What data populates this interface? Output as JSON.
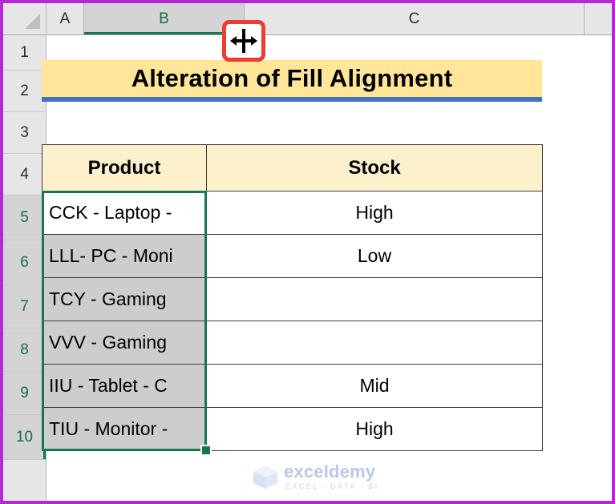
{
  "app": {
    "type": "spreadsheet",
    "colors": {
      "selection_green": "#16784a",
      "title_fill": "#ffe699",
      "title_underline": "#4472c4",
      "table_header_fill": "#fdf0cd",
      "selected_cell_fill": "#cdcdcd",
      "cursor_highlight": "#ee3b33",
      "outer_frame": "#b52ad0"
    }
  },
  "grid": {
    "select_all_corner": "select-all-triangle",
    "column_headers": [
      {
        "label": "A",
        "selected": false
      },
      {
        "label": "B",
        "selected": true
      },
      {
        "label": "C",
        "selected": false
      },
      {
        "label": "",
        "selected": false
      }
    ],
    "row_headers": [
      {
        "label": "1",
        "selected": false
      },
      {
        "label": "2",
        "selected": false
      },
      {
        "label": "3",
        "selected": false
      },
      {
        "label": "4",
        "selected": false
      },
      {
        "label": "5",
        "selected": true
      },
      {
        "label": "6",
        "selected": true
      },
      {
        "label": "7",
        "selected": true
      },
      {
        "label": "8",
        "selected": true
      },
      {
        "label": "9",
        "selected": true
      },
      {
        "label": "10",
        "selected": true
      }
    ]
  },
  "cursor": {
    "name": "column-resize-cursor",
    "glyph": "column-width-resize",
    "highlighted": true
  },
  "title": {
    "text": "Alteration of Fill Alignment"
  },
  "table": {
    "headers": [
      "Product",
      "Stock"
    ],
    "rows": [
      {
        "product": "CCK - Laptop -",
        "stock": "High",
        "active": true,
        "selected": true
      },
      {
        "product": "LLL- PC - Moni",
        "stock": "Low",
        "active": false,
        "selected": true
      },
      {
        "product": "TCY - Gaming",
        "stock": "",
        "active": false,
        "selected": true
      },
      {
        "product": "VVV - Gaming",
        "stock": "",
        "active": false,
        "selected": true
      },
      {
        "product": "IIU - Tablet - C",
        "stock": "Mid",
        "active": false,
        "selected": true
      },
      {
        "product": "TIU - Monitor -",
        "stock": "High",
        "active": false,
        "selected": true
      }
    ]
  },
  "watermark": {
    "title": "exceldemy",
    "tagline": "EXCEL - DATA - BI",
    "logo": "hexagon-cube-logo"
  }
}
